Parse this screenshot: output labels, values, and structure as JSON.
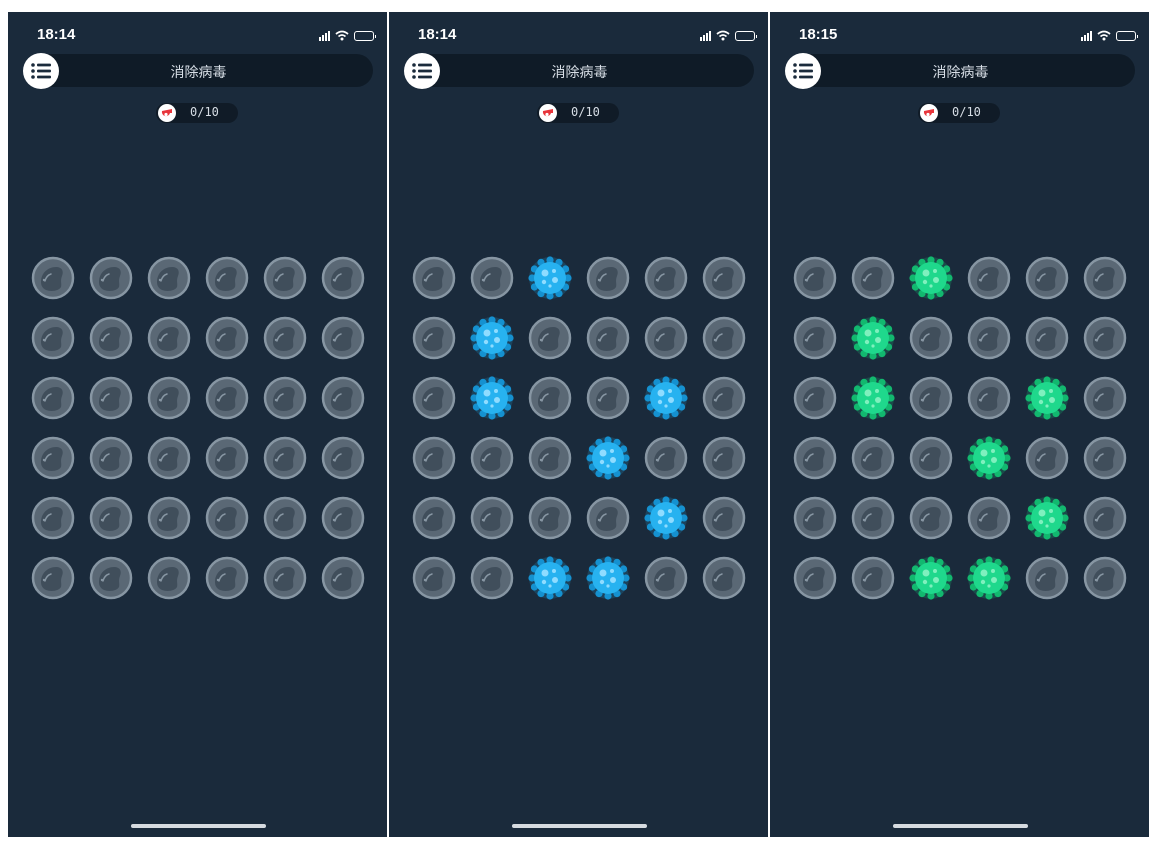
{
  "colors": {
    "background": "#1a2a3b",
    "cell_idle": "#5d6c7a",
    "virus_blue": "#27b2f0",
    "virus_green": "#1fd88c",
    "counter_icon": "#e8353b"
  },
  "screens": [
    {
      "time": "18:14",
      "title": "消除病毒",
      "counter": "0/10",
      "virus_color": "blue",
      "grid_rows": 6,
      "grid_cols": 6,
      "viruses": []
    },
    {
      "time": "18:14",
      "title": "消除病毒",
      "counter": "0/10",
      "virus_color": "blue",
      "grid_rows": 6,
      "grid_cols": 6,
      "viruses": [
        [
          0,
          2
        ],
        [
          1,
          1
        ],
        [
          2,
          1
        ],
        [
          2,
          4
        ],
        [
          3,
          3
        ],
        [
          4,
          4
        ],
        [
          5,
          2
        ],
        [
          5,
          3
        ]
      ]
    },
    {
      "time": "18:15",
      "title": "消除病毒",
      "counter": "0/10",
      "virus_color": "green",
      "grid_rows": 6,
      "grid_cols": 6,
      "viruses": [
        [
          0,
          2
        ],
        [
          1,
          1
        ],
        [
          2,
          1
        ],
        [
          2,
          4
        ],
        [
          3,
          3
        ],
        [
          4,
          4
        ],
        [
          5,
          2
        ],
        [
          5,
          3
        ]
      ]
    }
  ]
}
